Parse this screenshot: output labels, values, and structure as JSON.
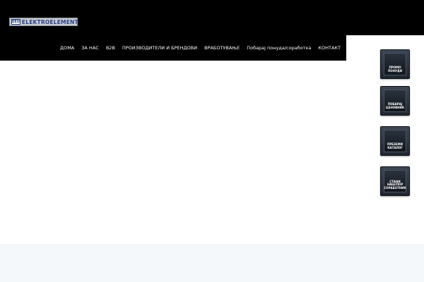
{
  "logo": {
    "mark": "EEU",
    "text": "ELEKTROELEMENT"
  },
  "nav": {
    "items": [
      {
        "label": "ДОМА"
      },
      {
        "label": "ЗА НАС"
      },
      {
        "label": "B2B"
      },
      {
        "label": "ПРОИЗВОДИТЕЛИ И БРЕНДОВИ"
      },
      {
        "label": "ВРАБОТУВАЊЕ"
      },
      {
        "label": "Побарај понуда/соработка"
      },
      {
        "label": "КОНТАКТ"
      }
    ]
  },
  "side_buttons": [
    {
      "label": "ПРОМО\nПОНУДИ"
    },
    {
      "label": "ПОБАРАЈ\nЦЕНОВНИК"
    },
    {
      "label": "ПРЕЗЕМИ\nКАТАЛОГ"
    },
    {
      "label": "СТАНИ\nНАШ/ПОР\nСОРАБОТНИК"
    }
  ],
  "colors": {
    "header_bg": "#000000",
    "nav_text": "#ffffff",
    "logo_text": "#2b3f86",
    "button_bg": "#2a323d",
    "footer_band": "#f4f8fa"
  }
}
